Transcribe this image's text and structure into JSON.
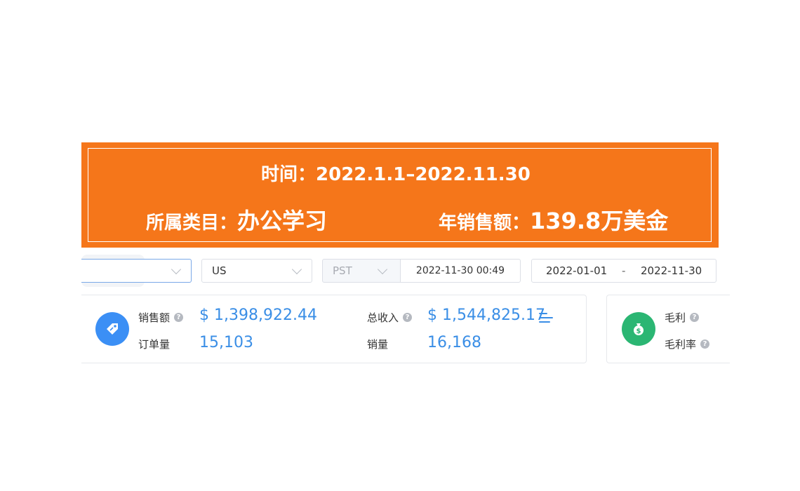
{
  "banner": {
    "time_label": "时间：",
    "time_value": "2022.1.1–2022.11.30",
    "category_label": "所属类目：",
    "category_value": "办公学习",
    "annual_sales_label": "年销售额：",
    "annual_sales_value": "139.8万美金",
    "color": "#f5761a"
  },
  "filters": {
    "store_select": {
      "value": "",
      "icon": "chevron-down-icon"
    },
    "country_select": {
      "value": "US",
      "icon": "chevron-down-icon"
    },
    "timezone_select": {
      "value": "PST",
      "icon": "chevron-down-icon"
    },
    "current_datetime": "2022-11-30 00:49",
    "date_range": {
      "start": "2022-01-01",
      "separator": "-",
      "end": "2022-11-30"
    }
  },
  "stats": {
    "sales_amount": {
      "label": "销售额",
      "value": "$ 1,398,922.44"
    },
    "order_count": {
      "label": "订单量",
      "value": "15,103"
    },
    "total_revenue": {
      "label": "总收入",
      "value": "$ 1,544,825.17"
    },
    "units_sold": {
      "label": "销量",
      "value": "16,168"
    },
    "gross_profit": {
      "label": "毛利"
    },
    "gross_margin": {
      "label": "毛利率"
    },
    "help_glyph": "?",
    "accent_color": "#3a8ee6",
    "sales_icon_color": "#3b8ff5",
    "profit_icon_color": "#2bb673"
  }
}
